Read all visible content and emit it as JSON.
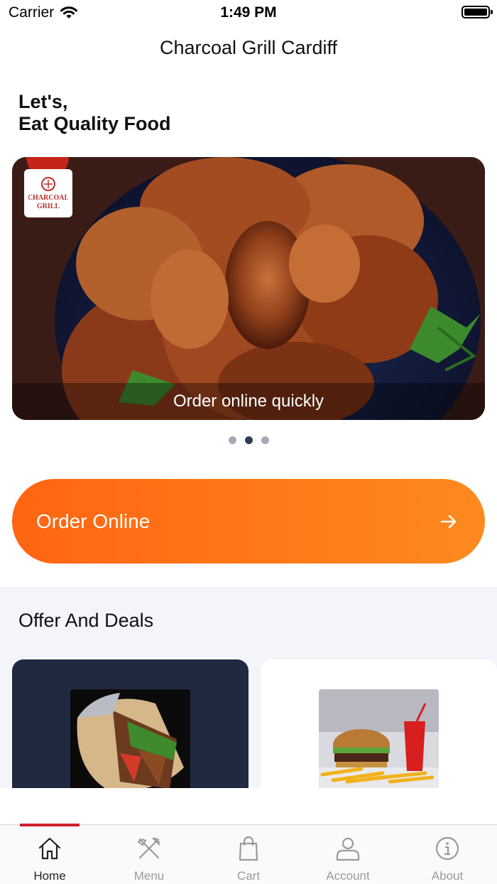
{
  "status_bar": {
    "carrier": "Carrier",
    "time": "1:49 PM"
  },
  "header": {
    "title": "Charcoal Grill Cardiff"
  },
  "greeting": {
    "line1": "Let's,",
    "line2": "Eat Quality Food"
  },
  "hero": {
    "caption": "Order online quickly",
    "logo_text_top": "CHARCOAL",
    "logo_text_bottom": "GRILL",
    "slide_count": 3,
    "active_slide": 2
  },
  "order_button": {
    "label": "Order Online",
    "icon": "arrow-right-icon"
  },
  "offers": {
    "title": "Offer And Deals"
  },
  "tabbar": {
    "items": [
      {
        "label": "Home",
        "icon": "home-icon",
        "active": true
      },
      {
        "label": "Menu",
        "icon": "fork-knife-icon",
        "active": false
      },
      {
        "label": "Cart",
        "icon": "shopping-bag-icon",
        "active": false
      },
      {
        "label": "Account",
        "icon": "user-icon",
        "active": false
      },
      {
        "label": "About",
        "icon": "info-icon",
        "active": false
      }
    ]
  },
  "colors": {
    "accent": "#ff6a14",
    "tab_indicator": "#cf1f2d",
    "dark_card": "#1f2940",
    "offers_bg": "#f4f5fb"
  }
}
